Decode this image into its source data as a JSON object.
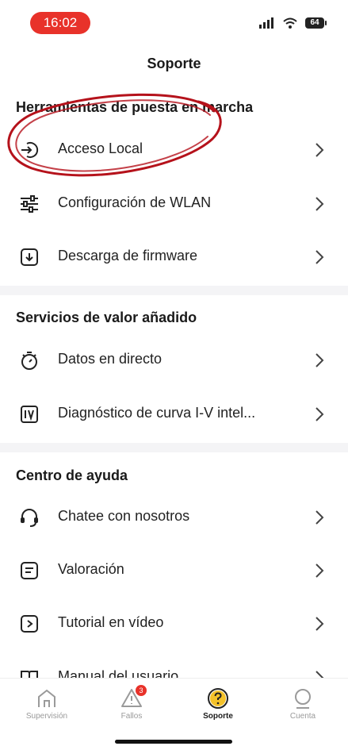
{
  "status_bar": {
    "time": "16:02",
    "battery": "64"
  },
  "header": {
    "title": "Soporte"
  },
  "sections": [
    {
      "title": "Herramientas de puesta en marcha",
      "items": [
        {
          "label": "Acceso Local",
          "icon": "login-arrow-icon"
        },
        {
          "label": "Configuración de WLAN",
          "icon": "sliders-icon"
        },
        {
          "label": "Descarga de firmware",
          "icon": "download-box-icon"
        }
      ]
    },
    {
      "title": "Servicios de valor añadido",
      "items": [
        {
          "label": "Datos en directo",
          "icon": "stopwatch-icon"
        },
        {
          "label": "Diagnóstico de curva I-V intel...",
          "icon": "iv-icon"
        }
      ]
    },
    {
      "title": "Centro de ayuda",
      "items": [
        {
          "label": "Chatee con nosotros",
          "icon": "headset-icon"
        },
        {
          "label": "Valoración",
          "icon": "rating-note-icon"
        },
        {
          "label": "Tutorial en vídeo",
          "icon": "video-play-icon"
        },
        {
          "label": "Manual del usuario",
          "icon": "book-icon"
        }
      ]
    }
  ],
  "tabs": [
    {
      "label": "Supervisión",
      "icon": "home-icon"
    },
    {
      "label": "Fallos",
      "icon": "warning-icon",
      "badge": "3"
    },
    {
      "label": "Soporte",
      "icon": "question-icon"
    },
    {
      "label": "Cuenta",
      "icon": "user-icon"
    }
  ],
  "colors": {
    "accent": "#e8322a",
    "annotation": "#b5121b",
    "active_tab_ring": "#f2b705"
  }
}
